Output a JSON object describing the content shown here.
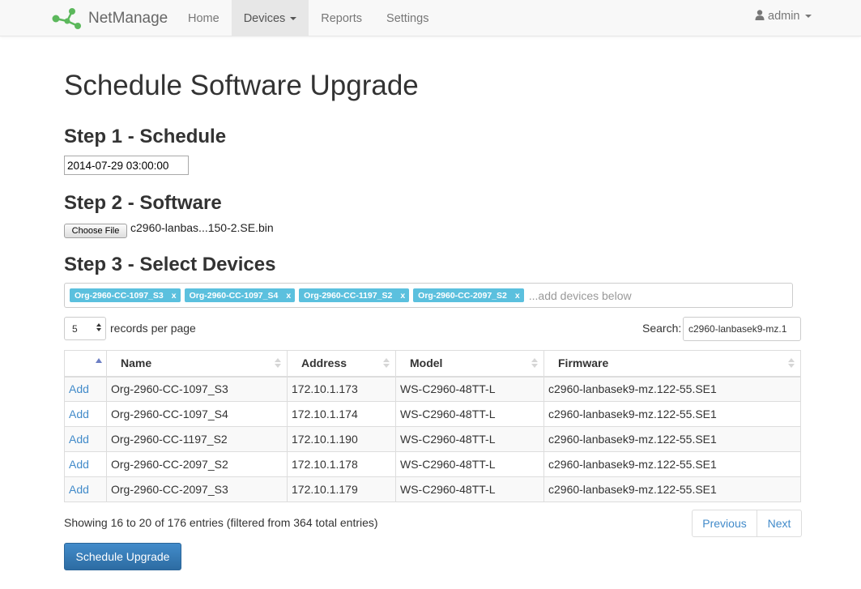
{
  "app": {
    "brand": "NetManage",
    "nav": [
      {
        "label": "Home"
      },
      {
        "label": "Devices"
      },
      {
        "label": "Reports"
      },
      {
        "label": "Settings"
      }
    ],
    "user": "admin"
  },
  "page": {
    "title": "Schedule Software Upgrade",
    "step1": {
      "title": "Step 1 - Schedule",
      "datetime": "2014-07-29 03:00:00"
    },
    "step2": {
      "title": "Step 2 - Software",
      "button": "Choose File",
      "file": "c2960-lanbas...150-2.SE.bin"
    },
    "step3": {
      "title": "Step 3 - Select Devices",
      "tags": [
        "Org-2960-CC-1097_S3",
        "Org-2960-CC-1097_S4",
        "Org-2960-CC-1197_S2",
        "Org-2960-CC-2097_S2"
      ],
      "tag_remove": "x",
      "placeholder": "...add devices below"
    }
  },
  "table": {
    "length_value": "5",
    "length_label": "records per page",
    "search_label": "Search:",
    "search_value": "c2960-lanbasek9-mz.1",
    "columns": [
      "",
      "Name",
      "Address",
      "Model",
      "Firmware"
    ],
    "rows": [
      {
        "action": "Add",
        "name": "Org-2960-CC-1097_S3",
        "address": "172.10.1.173",
        "model": "WS-C2960-48TT-L",
        "firmware": "c2960-lanbasek9-mz.122-55.SE1"
      },
      {
        "action": "Add",
        "name": "Org-2960-CC-1097_S4",
        "address": "172.10.1.174",
        "model": "WS-C2960-48TT-L",
        "firmware": "c2960-lanbasek9-mz.122-55.SE1"
      },
      {
        "action": "Add",
        "name": "Org-2960-CC-1197_S2",
        "address": "172.10.1.190",
        "model": "WS-C2960-48TT-L",
        "firmware": "c2960-lanbasek9-mz.122-55.SE1"
      },
      {
        "action": "Add",
        "name": "Org-2960-CC-2097_S2",
        "address": "172.10.1.178",
        "model": "WS-C2960-48TT-L",
        "firmware": "c2960-lanbasek9-mz.122-55.SE1"
      },
      {
        "action": "Add",
        "name": "Org-2960-CC-2097_S3",
        "address": "172.10.1.179",
        "model": "WS-C2960-48TT-L",
        "firmware": "c2960-lanbasek9-mz.122-55.SE1"
      }
    ],
    "info": "Showing 16 to 20 of 176 entries (filtered from 364 total entries)",
    "prev": "Previous",
    "next": "Next"
  },
  "submit": "Schedule Upgrade",
  "icons": {
    "brand": "network-logo-icon",
    "user": "user-icon",
    "caret": "caret-down-icon"
  },
  "colors": {
    "primary": "#428bca",
    "tag": "#5bc0de",
    "navbar": "#f8f8f8",
    "brand_green": "#5cb85c"
  }
}
